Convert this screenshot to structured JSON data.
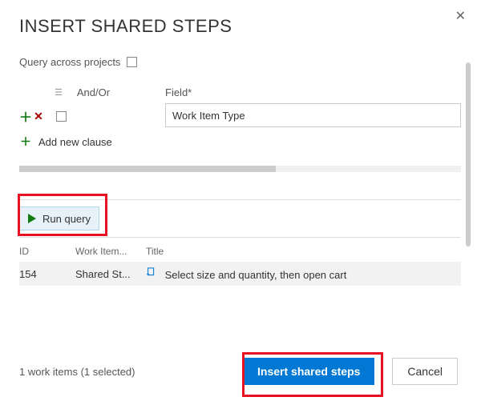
{
  "dialog": {
    "title": "INSERT SHARED STEPS"
  },
  "query": {
    "across_projects_label": "Query across projects",
    "andor_header": "And/Or",
    "field_header": "Field*",
    "field_value": "Work Item Type",
    "add_clause_label": "Add new clause",
    "run_query_label": "Run query"
  },
  "grid": {
    "columns": {
      "id": "ID",
      "wit": "Work Item...",
      "title": "Title"
    },
    "rows": [
      {
        "id": "154",
        "wit": "Shared St...",
        "title": "Select size and quantity, then open cart"
      }
    ]
  },
  "footer": {
    "status": "1 work items (1 selected)",
    "insert_label": "Insert shared steps",
    "cancel_label": "Cancel"
  }
}
